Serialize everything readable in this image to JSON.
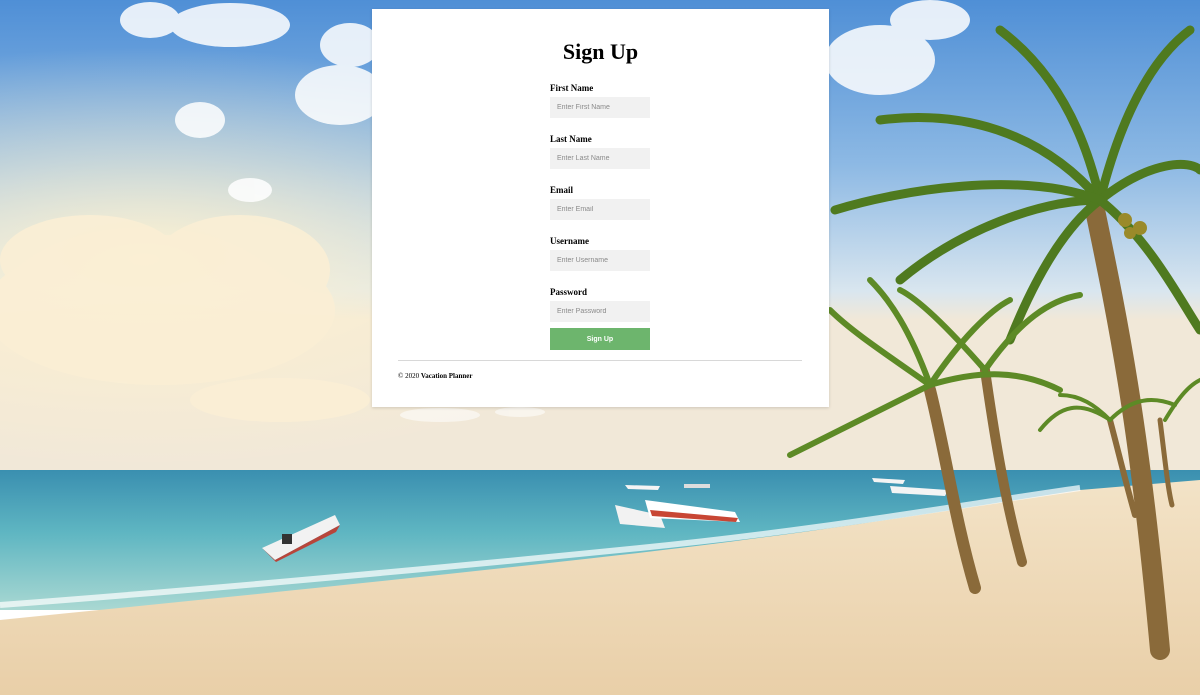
{
  "page": {
    "title": "Sign Up"
  },
  "form": {
    "fields": [
      {
        "label": "First Name",
        "placeholder": "Enter First Name",
        "value": ""
      },
      {
        "label": "Last Name",
        "placeholder": "Enter Last Name",
        "value": ""
      },
      {
        "label": "Email",
        "placeholder": "Enter Email",
        "value": ""
      },
      {
        "label": "Username",
        "placeholder": "Enter Username",
        "value": ""
      },
      {
        "label": "Password",
        "placeholder": "Enter Password",
        "value": ""
      }
    ],
    "submit_label": "Sign Up"
  },
  "footer": {
    "copyright": "© 2020",
    "brand": "Vacation Planner"
  },
  "colors": {
    "button": "#6db56d",
    "input_bg": "#f1f1f1",
    "card_bg": "#ffffff"
  },
  "background": {
    "scene": "tropical beach with palm trees, boats and ocean"
  }
}
